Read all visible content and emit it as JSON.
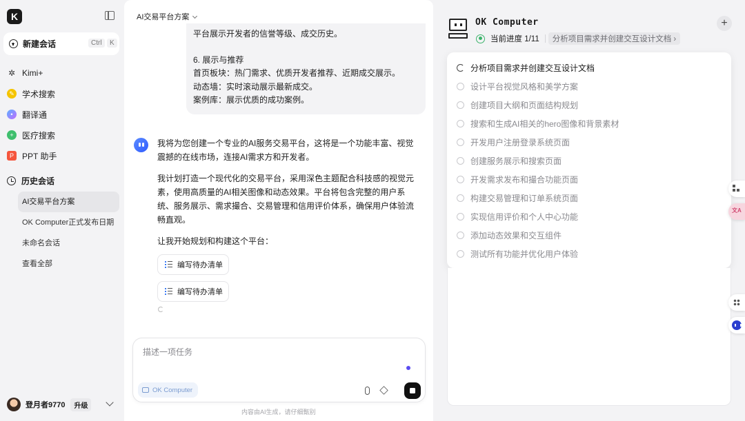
{
  "sidebar": {
    "logo": "K",
    "new_chat": {
      "label": "新建会话",
      "shortcut_ctrl": "Ctrl",
      "shortcut_key": "K"
    },
    "nav": [
      {
        "label": "Kimi+",
        "icon": "kimi-plus-icon"
      },
      {
        "label": "学术搜索",
        "icon": "scholar-icon"
      },
      {
        "label": "翻译通",
        "icon": "translate-icon"
      },
      {
        "label": "医疗搜索",
        "icon": "medical-icon"
      },
      {
        "label": "PPT 助手",
        "icon": "ppt-icon"
      }
    ],
    "history_title": "历史会话",
    "history": [
      {
        "label": "AI交易平台方案"
      },
      {
        "label": "OK Computer正式发布日期"
      },
      {
        "label": "未命名会话"
      },
      {
        "label": "查看全部"
      }
    ],
    "user": {
      "name": "登月者9770",
      "upgrade_label": "升级"
    }
  },
  "main": {
    "conversation_title": "AI交易平台方案",
    "user_message": {
      "line1": "平台展示开发者的信誉等级、成交历史。",
      "heading": "6. 展示与推荐",
      "line2": "首页板块：热门需求、优质开发者推荐、近期成交展示。",
      "line3": "动态墙：实时滚动展示最新成交。",
      "line4": "案例库：展示优质的成功案例。"
    },
    "assistant": {
      "para1": "我将为您创建一个专业的AI服务交易平台，这将是一个功能丰富、视觉震撼的在线市场，连接AI需求方和开发者。",
      "para2": "我计划打造一个现代化的交易平台，采用深色主题配合科技感的视觉元素，使用高质量的AI相关图像和动态效果。平台将包含完整的用户系统、服务展示、需求撮合、交易管理和信用评价体系，确保用户体验流畅直观。",
      "para3": "让我开始规划和构建这个平台：",
      "tool_calls": [
        {
          "label": "编写待办清单"
        },
        {
          "label": "编写待办清单"
        }
      ]
    },
    "composer": {
      "placeholder": "描述一项任务",
      "mode_label": "OK Computer"
    },
    "disclaimer": "内容由AI生成，请仔细甄别"
  },
  "panel": {
    "title": "OK Computer",
    "progress_label": "当前进度 1/11",
    "current_task": "分析项目需求并创建交互设计文档 ›",
    "tasks": [
      {
        "label": "分析项目需求并创建交互设计文档",
        "status": "in-progress"
      },
      {
        "label": "设计平台视觉风格和美学方案",
        "status": "pending"
      },
      {
        "label": "创建项目大纲和页面结构规划",
        "status": "pending"
      },
      {
        "label": "搜索和生成AI相关的hero图像和背景素材",
        "status": "pending"
      },
      {
        "label": "开发用户注册登录系统页面",
        "status": "pending"
      },
      {
        "label": "创建服务展示和搜索页面",
        "status": "pending"
      },
      {
        "label": "开发需求发布和撮合功能页面",
        "status": "pending"
      },
      {
        "label": "构建交易管理和订单系统页面",
        "status": "pending"
      },
      {
        "label": "实现信用评价和个人中心功能",
        "status": "pending"
      },
      {
        "label": "添加动态效果和交互组件",
        "status": "pending"
      },
      {
        "label": "测试所有功能并优化用户体验",
        "status": "pending"
      }
    ]
  },
  "colors": {
    "accent_green": "#3bb36a",
    "accent_blue": "#2f5bff",
    "stop_button": "#111111"
  }
}
